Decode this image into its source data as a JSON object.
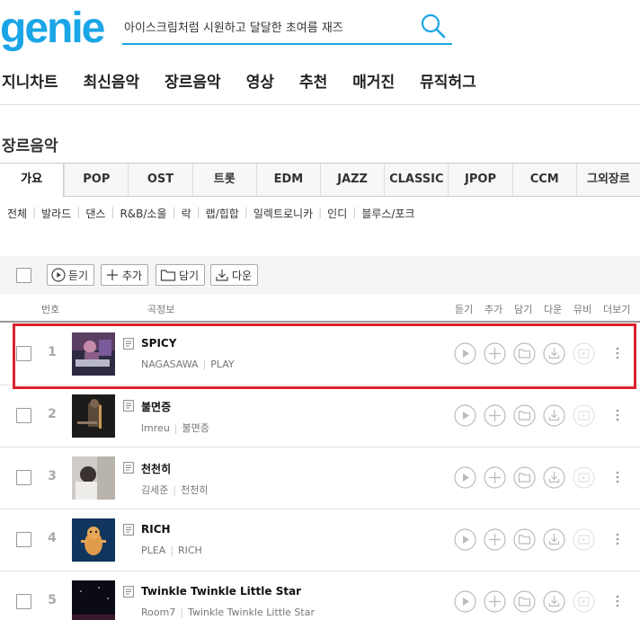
{
  "header": {
    "logo": "genie",
    "search_placeholder": "아이스크림처럼 시원하고 달달한 초여름 재즈"
  },
  "gnb": [
    "지니차트",
    "최신음악",
    "장르음악",
    "영상",
    "추천",
    "매거진",
    "뮤직허그"
  ],
  "page_title": "장르음악",
  "genre_tabs": [
    "가요",
    "POP",
    "OST",
    "트롯",
    "EDM",
    "JAZZ",
    "CLASSIC",
    "JPOP",
    "CCM",
    "그외장르"
  ],
  "active_tab": "가요",
  "subgenres": [
    "전체",
    "발라드",
    "댄스",
    "R&B/소울",
    "락",
    "랩/힙합",
    "일렉트로니카",
    "인디",
    "블루스/포크"
  ],
  "toolbar": {
    "listen": "듣기",
    "add": "추가",
    "save": "담기",
    "download": "다운"
  },
  "columns": {
    "number": "번호",
    "info": "곡정보",
    "listen": "듣기",
    "add": "추가",
    "save": "담기",
    "download": "다운",
    "mv": "뮤비",
    "more": "더보기"
  },
  "songs": [
    {
      "rank": "1",
      "title": "SPICY",
      "artist": "NAGASAWA",
      "album": "PLAY"
    },
    {
      "rank": "2",
      "title": "불면증",
      "artist": "lmreu",
      "album": "불면증"
    },
    {
      "rank": "3",
      "title": "천천히",
      "artist": "김세준",
      "album": "천천히"
    },
    {
      "rank": "4",
      "title": "RICH",
      "artist": "PLEA",
      "album": "RICH"
    },
    {
      "rank": "5",
      "title": "Twinkle Twinkle Little Star",
      "artist": "Room7",
      "album": "Twinkle Twinkle Little Star"
    }
  ],
  "colors": {
    "brand": "#1aa5e6",
    "highlight": "#d9232d"
  }
}
